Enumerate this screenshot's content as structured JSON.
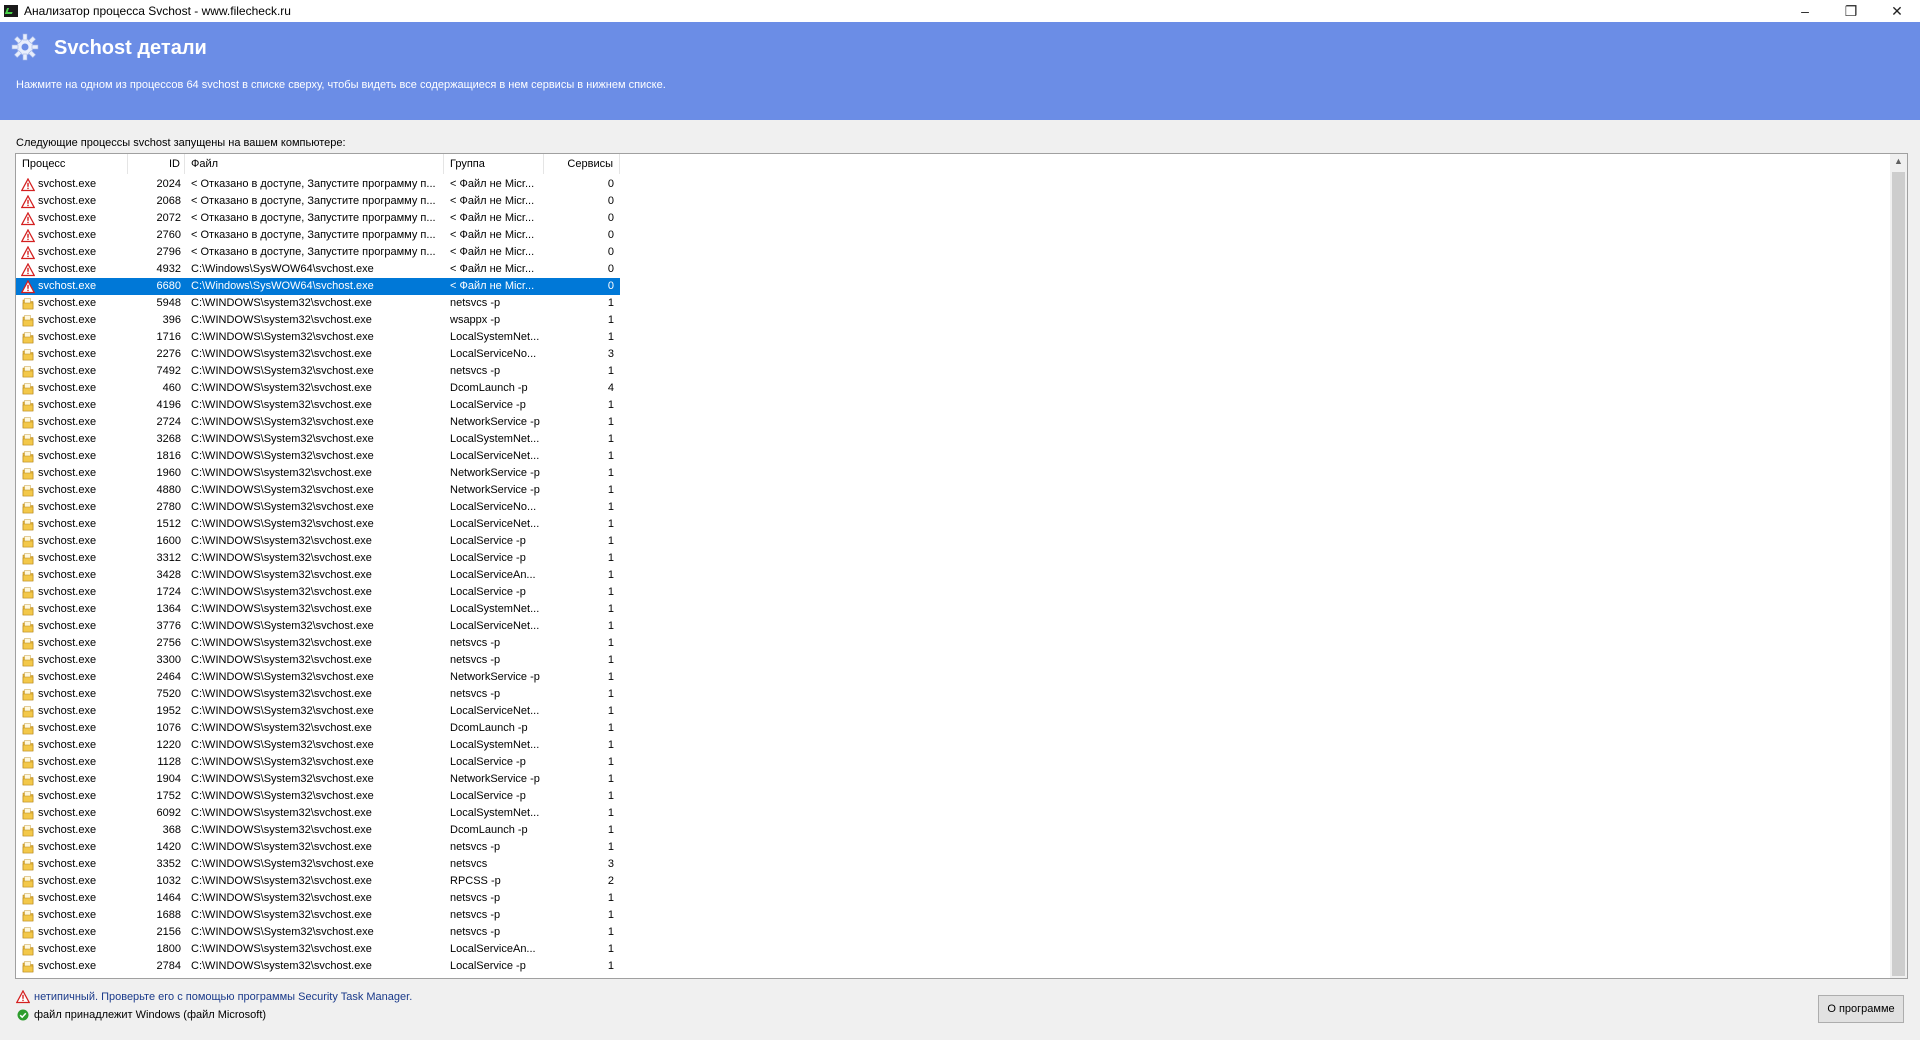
{
  "window": {
    "title": "Анализатор процесса Svchost - www.filecheck.ru",
    "controls": [
      "minimize-icon",
      "restore-icon",
      "close-icon"
    ]
  },
  "banner": {
    "title": "Svchost детали",
    "description": "Нажмите на одном из процессов 64 svchost в списке сверху, чтобы видеть все содержащиеся в нем сервисы в нижнем списке.",
    "background": "#6b8de6"
  },
  "list_caption": "Следующие процессы svchost запущены на вашем компьютере:",
  "columns": {
    "process": "Процесс",
    "id": "ID",
    "file": "Файл",
    "group": "Группа",
    "services": "Сервисы"
  },
  "selected_row": 6,
  "rows": [
    {
      "icon": "warning-icon",
      "process": "svchost.exe",
      "id": "2024",
      "file": "< Отказано в доступе, Запустите программу п...",
      "group": "< Файл не Micr...",
      "services": "0"
    },
    {
      "icon": "warning-icon",
      "process": "svchost.exe",
      "id": "2068",
      "file": "< Отказано в доступе, Запустите программу п...",
      "group": "< Файл не Micr...",
      "services": "0"
    },
    {
      "icon": "warning-icon",
      "process": "svchost.exe",
      "id": "2072",
      "file": "< Отказано в доступе, Запустите программу п...",
      "group": "< Файл не Micr...",
      "services": "0"
    },
    {
      "icon": "warning-icon",
      "process": "svchost.exe",
      "id": "2760",
      "file": "< Отказано в доступе, Запустите программу п...",
      "group": "< Файл не Micr...",
      "services": "0"
    },
    {
      "icon": "warning-icon",
      "process": "svchost.exe",
      "id": "2796",
      "file": "< Отказано в доступе, Запустите программу п...",
      "group": "< Файл не Micr...",
      "services": "0"
    },
    {
      "icon": "warning-icon",
      "process": "svchost.exe",
      "id": "4932",
      "file": "C:\\Windows\\SysWOW64\\svchost.exe",
      "group": "< Файл не Micr...",
      "services": "0"
    },
    {
      "icon": "warning-icon",
      "process": "svchost.exe",
      "id": "6680",
      "file": "C:\\Windows\\SysWOW64\\svchost.exe",
      "group": "< Файл не Micr...",
      "services": "0"
    },
    {
      "icon": "folder-icon",
      "process": "svchost.exe",
      "id": "5948",
      "file": "C:\\WINDOWS\\system32\\svchost.exe",
      "group": "netsvcs -p",
      "services": "1"
    },
    {
      "icon": "folder-icon",
      "process": "svchost.exe",
      "id": "396",
      "file": "C:\\WINDOWS\\system32\\svchost.exe",
      "group": "wsappx -p",
      "services": "1"
    },
    {
      "icon": "folder-icon",
      "process": "svchost.exe",
      "id": "1716",
      "file": "C:\\WINDOWS\\System32\\svchost.exe",
      "group": "LocalSystemNet...",
      "services": "1"
    },
    {
      "icon": "folder-icon",
      "process": "svchost.exe",
      "id": "2276",
      "file": "C:\\WINDOWS\\system32\\svchost.exe",
      "group": "LocalServiceNo...",
      "services": "3"
    },
    {
      "icon": "folder-icon",
      "process": "svchost.exe",
      "id": "7492",
      "file": "C:\\WINDOWS\\System32\\svchost.exe",
      "group": "netsvcs -p",
      "services": "1"
    },
    {
      "icon": "folder-icon",
      "process": "svchost.exe",
      "id": "460",
      "file": "C:\\WINDOWS\\system32\\svchost.exe",
      "group": "DcomLaunch -p",
      "services": "4"
    },
    {
      "icon": "folder-icon",
      "process": "svchost.exe",
      "id": "4196",
      "file": "C:\\WINDOWS\\system32\\svchost.exe",
      "group": "LocalService -p",
      "services": "1"
    },
    {
      "icon": "folder-icon",
      "process": "svchost.exe",
      "id": "2724",
      "file": "C:\\WINDOWS\\System32\\svchost.exe",
      "group": "NetworkService -p",
      "services": "1"
    },
    {
      "icon": "folder-icon",
      "process": "svchost.exe",
      "id": "3268",
      "file": "C:\\WINDOWS\\System32\\svchost.exe",
      "group": "LocalSystemNet...",
      "services": "1"
    },
    {
      "icon": "folder-icon",
      "process": "svchost.exe",
      "id": "1816",
      "file": "C:\\WINDOWS\\System32\\svchost.exe",
      "group": "LocalServiceNet...",
      "services": "1"
    },
    {
      "icon": "folder-icon",
      "process": "svchost.exe",
      "id": "1960",
      "file": "C:\\WINDOWS\\system32\\svchost.exe",
      "group": "NetworkService -p",
      "services": "1"
    },
    {
      "icon": "folder-icon",
      "process": "svchost.exe",
      "id": "4880",
      "file": "C:\\WINDOWS\\System32\\svchost.exe",
      "group": "NetworkService -p",
      "services": "1"
    },
    {
      "icon": "folder-icon",
      "process": "svchost.exe",
      "id": "2780",
      "file": "C:\\WINDOWS\\System32\\svchost.exe",
      "group": "LocalServiceNo...",
      "services": "1"
    },
    {
      "icon": "folder-icon",
      "process": "svchost.exe",
      "id": "1512",
      "file": "C:\\WINDOWS\\System32\\svchost.exe",
      "group": "LocalServiceNet...",
      "services": "1"
    },
    {
      "icon": "folder-icon",
      "process": "svchost.exe",
      "id": "1600",
      "file": "C:\\WINDOWS\\system32\\svchost.exe",
      "group": "LocalService -p",
      "services": "1"
    },
    {
      "icon": "folder-icon",
      "process": "svchost.exe",
      "id": "3312",
      "file": "C:\\WINDOWS\\system32\\svchost.exe",
      "group": "LocalService -p",
      "services": "1"
    },
    {
      "icon": "folder-icon",
      "process": "svchost.exe",
      "id": "3428",
      "file": "C:\\WINDOWS\\system32\\svchost.exe",
      "group": "LocalServiceAn...",
      "services": "1"
    },
    {
      "icon": "folder-icon",
      "process": "svchost.exe",
      "id": "1724",
      "file": "C:\\WINDOWS\\system32\\svchost.exe",
      "group": "LocalService -p",
      "services": "1"
    },
    {
      "icon": "folder-icon",
      "process": "svchost.exe",
      "id": "1364",
      "file": "C:\\WINDOWS\\system32\\svchost.exe",
      "group": "LocalSystemNet...",
      "services": "1"
    },
    {
      "icon": "folder-icon",
      "process": "svchost.exe",
      "id": "3776",
      "file": "C:\\WINDOWS\\System32\\svchost.exe",
      "group": "LocalServiceNet...",
      "services": "1"
    },
    {
      "icon": "folder-icon",
      "process": "svchost.exe",
      "id": "2756",
      "file": "C:\\WINDOWS\\system32\\svchost.exe",
      "group": "netsvcs -p",
      "services": "1"
    },
    {
      "icon": "folder-icon",
      "process": "svchost.exe",
      "id": "3300",
      "file": "C:\\WINDOWS\\system32\\svchost.exe",
      "group": "netsvcs -p",
      "services": "1"
    },
    {
      "icon": "folder-icon",
      "process": "svchost.exe",
      "id": "2464",
      "file": "C:\\WINDOWS\\System32\\svchost.exe",
      "group": "NetworkService -p",
      "services": "1"
    },
    {
      "icon": "folder-icon",
      "process": "svchost.exe",
      "id": "7520",
      "file": "C:\\WINDOWS\\system32\\svchost.exe",
      "group": "netsvcs -p",
      "services": "1"
    },
    {
      "icon": "folder-icon",
      "process": "svchost.exe",
      "id": "1952",
      "file": "C:\\WINDOWS\\System32\\svchost.exe",
      "group": "LocalServiceNet...",
      "services": "1"
    },
    {
      "icon": "folder-icon",
      "process": "svchost.exe",
      "id": "1076",
      "file": "C:\\WINDOWS\\system32\\svchost.exe",
      "group": "DcomLaunch -p",
      "services": "1"
    },
    {
      "icon": "folder-icon",
      "process": "svchost.exe",
      "id": "1220",
      "file": "C:\\WINDOWS\\System32\\svchost.exe",
      "group": "LocalSystemNet...",
      "services": "1"
    },
    {
      "icon": "folder-icon",
      "process": "svchost.exe",
      "id": "1128",
      "file": "C:\\WINDOWS\\System32\\svchost.exe",
      "group": "LocalService -p",
      "services": "1"
    },
    {
      "icon": "folder-icon",
      "process": "svchost.exe",
      "id": "1904",
      "file": "C:\\WINDOWS\\System32\\svchost.exe",
      "group": "NetworkService -p",
      "services": "1"
    },
    {
      "icon": "folder-icon",
      "process": "svchost.exe",
      "id": "1752",
      "file": "C:\\WINDOWS\\System32\\svchost.exe",
      "group": "LocalService -p",
      "services": "1"
    },
    {
      "icon": "folder-icon",
      "process": "svchost.exe",
      "id": "6092",
      "file": "C:\\WINDOWS\\system32\\svchost.exe",
      "group": "LocalSystemNet...",
      "services": "1"
    },
    {
      "icon": "folder-icon",
      "process": "svchost.exe",
      "id": "368",
      "file": "C:\\WINDOWS\\system32\\svchost.exe",
      "group": "DcomLaunch -p",
      "services": "1"
    },
    {
      "icon": "folder-icon",
      "process": "svchost.exe",
      "id": "1420",
      "file": "C:\\WINDOWS\\system32\\svchost.exe",
      "group": "netsvcs -p",
      "services": "1"
    },
    {
      "icon": "folder-icon",
      "process": "svchost.exe",
      "id": "3352",
      "file": "C:\\WINDOWS\\System32\\svchost.exe",
      "group": "netsvcs",
      "services": "3"
    },
    {
      "icon": "folder-icon",
      "process": "svchost.exe",
      "id": "1032",
      "file": "C:\\WINDOWS\\system32\\svchost.exe",
      "group": "RPCSS -p",
      "services": "2"
    },
    {
      "icon": "folder-icon",
      "process": "svchost.exe",
      "id": "1464",
      "file": "C:\\WINDOWS\\system32\\svchost.exe",
      "group": "netsvcs -p",
      "services": "1"
    },
    {
      "icon": "folder-icon",
      "process": "svchost.exe",
      "id": "1688",
      "file": "C:\\WINDOWS\\system32\\svchost.exe",
      "group": "netsvcs -p",
      "services": "1"
    },
    {
      "icon": "folder-icon",
      "process": "svchost.exe",
      "id": "2156",
      "file": "C:\\WINDOWS\\System32\\svchost.exe",
      "group": "netsvcs -p",
      "services": "1"
    },
    {
      "icon": "folder-icon",
      "process": "svchost.exe",
      "id": "1800",
      "file": "C:\\WINDOWS\\system32\\svchost.exe",
      "group": "LocalServiceAn...",
      "services": "1"
    },
    {
      "icon": "folder-icon",
      "process": "svchost.exe",
      "id": "2784",
      "file": "C:\\WINDOWS\\system32\\svchost.exe",
      "group": "LocalService -p",
      "services": "1"
    }
  ],
  "legend": {
    "warning_text": "нетипичный. Проверьте его с помощью программы Security Task Manager.",
    "ok_text": "файл принадлежит Windows (файл Microsoft)"
  },
  "about_button": "О программе",
  "colors": {
    "selection": "#0078d7",
    "warning": "#d42020",
    "ok": "#2e9d2e",
    "folder": "#e8b83a"
  }
}
